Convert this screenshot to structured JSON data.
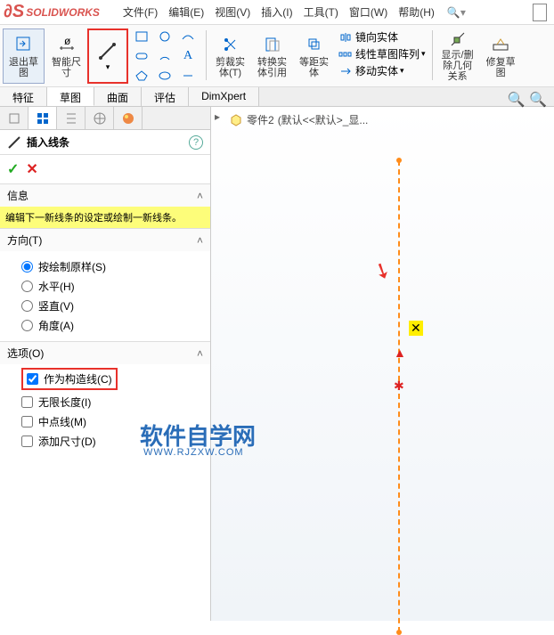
{
  "app": {
    "name": "SOLIDWORKS"
  },
  "menu": {
    "file": "文件(F)",
    "edit": "编辑(E)",
    "view": "视图(V)",
    "insert": "插入(I)",
    "tools": "工具(T)",
    "window": "窗口(W)",
    "help": "帮助(H)"
  },
  "toolbar": {
    "exit_sketch": "退出草\n图",
    "smart_dim": "智能尺\n寸",
    "trim": "剪裁实\n体(T)",
    "convert": "转换实\n体引用",
    "offset": "等距实\n体",
    "mirror": "镜向实体",
    "linear_pattern": "线性草图阵列",
    "move": "移动实体",
    "display_del": "显示/删\n除几何\n关系",
    "repair": "修复草\n图"
  },
  "sub_tabs": {
    "feature": "特征",
    "sketch": "草图",
    "surface": "曲面",
    "evaluate": "评估",
    "dimxpert": "DimXpert"
  },
  "panel": {
    "title": "插入线条",
    "help": "?",
    "info_title": "信息",
    "info_text": "编辑下一新线条的设定或绘制一新线条。",
    "direction_title": "方向(T)",
    "dir": {
      "sketch": "按绘制原样(S)",
      "horiz": "水平(H)",
      "vert": "竖直(V)",
      "angle": "角度(A)"
    },
    "options_title": "选项(O)",
    "opts": {
      "construction": "作为构造线(C)",
      "infinite": "无限长度(I)",
      "midpoint": "中点线(M)",
      "add_dim": "添加尺寸(D)"
    }
  },
  "crumb": {
    "part": "零件2",
    "state": "(默认<<默认>_显..."
  },
  "watermark": {
    "text": "软件自学网",
    "url": "WWW.RJZXW.COM"
  }
}
